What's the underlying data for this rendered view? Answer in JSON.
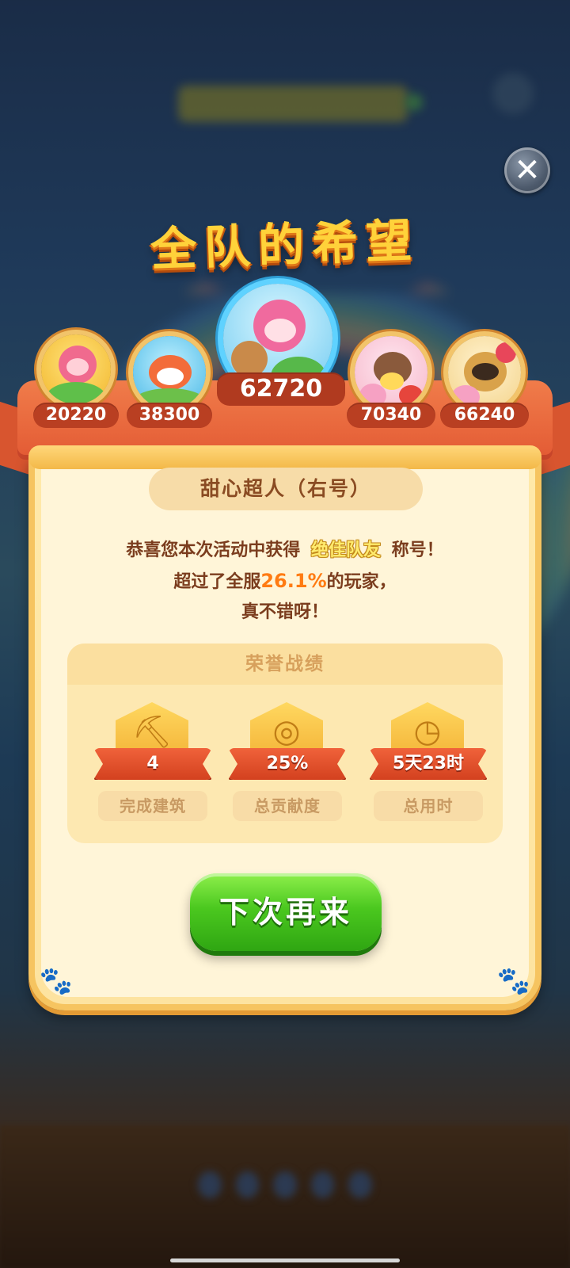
{
  "header": {
    "title": "全队的希望",
    "close_icon": "close-icon"
  },
  "team": {
    "members": [
      {
        "score": "20220",
        "icon": "avatar-pink-lion"
      },
      {
        "score": "38300",
        "icon": "avatar-orange-bird"
      },
      {
        "score": "62720",
        "icon": "avatar-pink-girl-bear",
        "featured": true
      },
      {
        "score": "70340",
        "icon": "avatar-cupcake-chick"
      },
      {
        "score": "66240",
        "icon": "avatar-raccoon"
      }
    ]
  },
  "player": {
    "name": "甜心超人（右号）"
  },
  "message": {
    "line1_prefix": "恭喜您本次活动中获得",
    "line1_title": "绝佳队友",
    "line1_suffix": "称号！",
    "line2_prefix": "超过了全服",
    "line2_percent": "26.1%",
    "line2_suffix": "的玩家，",
    "line3": "真不错呀！"
  },
  "honor": {
    "title": "荣誉战绩",
    "stats": [
      {
        "value": "4",
        "label": "完成建筑",
        "icon": "shovel-icon"
      },
      {
        "value": "25%",
        "label": "总贡献度",
        "icon": "target-icon"
      },
      {
        "value": "5天23时",
        "label": "总用时",
        "icon": "clock-icon"
      }
    ]
  },
  "actions": {
    "again_label": "下次再来"
  },
  "colors": {
    "accent_orange": "#e35a34",
    "gold": "#ffd23a",
    "green": "#4bc81f",
    "brown_text": "#7b3d1e"
  }
}
